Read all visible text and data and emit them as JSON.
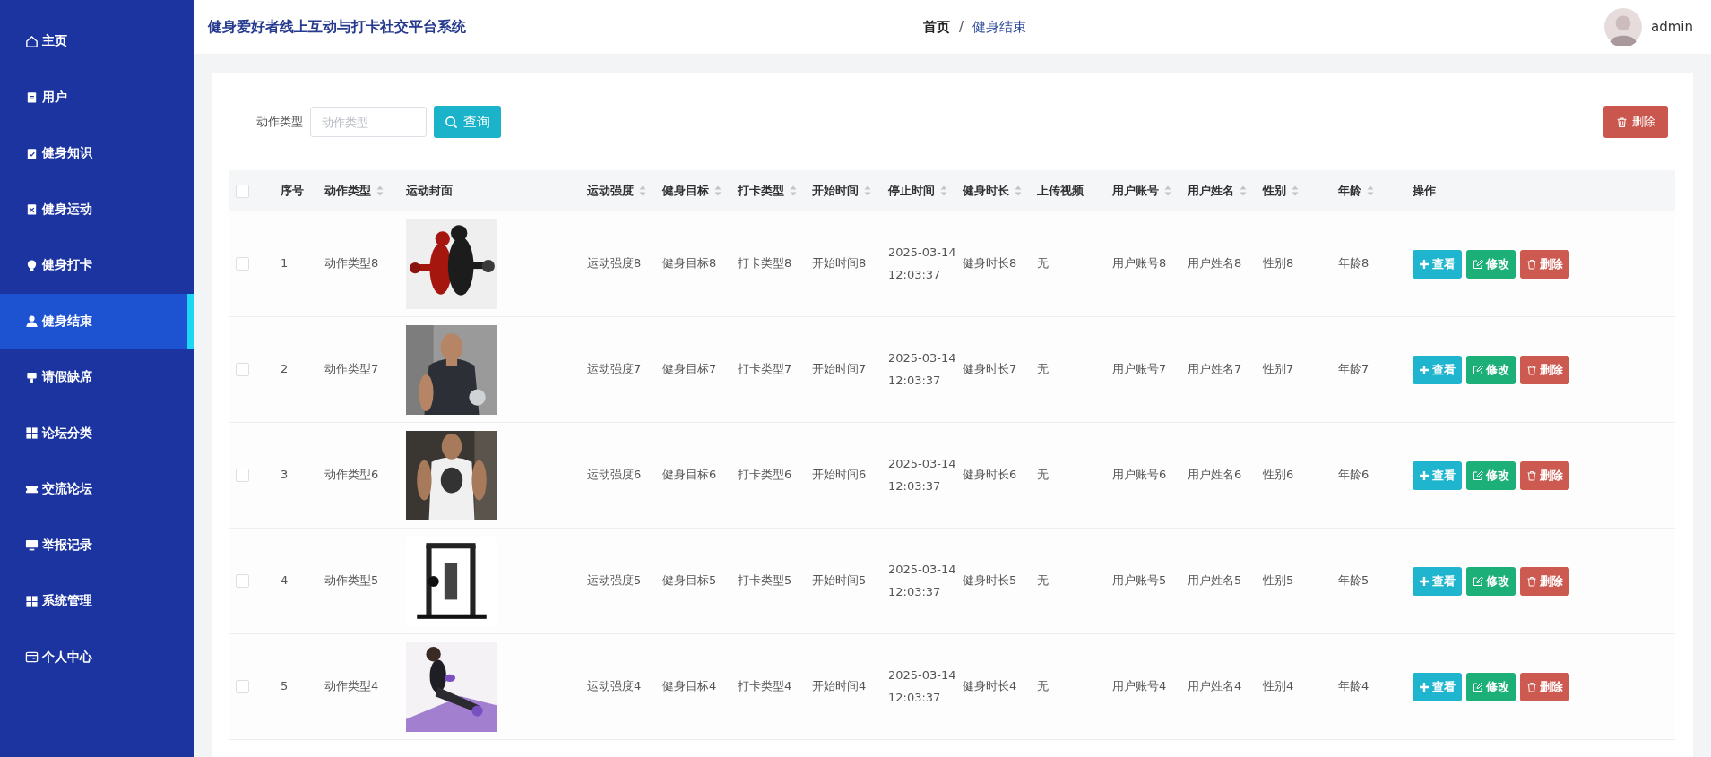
{
  "sidebar": {
    "items": [
      {
        "label": "主页",
        "selected": false
      },
      {
        "label": "用户",
        "selected": false
      },
      {
        "label": "健身知识",
        "selected": false
      },
      {
        "label": "健身运动",
        "selected": false
      },
      {
        "label": "健身打卡",
        "selected": false
      },
      {
        "label": "健身结束",
        "selected": true
      },
      {
        "label": "请假缺席",
        "selected": false
      },
      {
        "label": "论坛分类",
        "selected": false
      },
      {
        "label": "交流论坛",
        "selected": false
      },
      {
        "label": "举报记录",
        "selected": false
      },
      {
        "label": "系统管理",
        "selected": false
      },
      {
        "label": "个人中心",
        "selected": false
      }
    ]
  },
  "header": {
    "title": "健身爱好者线上互动与打卡社交平台系统",
    "breadcrumb": [
      "首页",
      "/",
      "健身结束"
    ],
    "user": "admin"
  },
  "search": {
    "label": "动作类型",
    "placeholder": "动作类型",
    "button": "查询"
  },
  "delete_button": "删除",
  "table": {
    "select_all": {
      "checked": false
    },
    "columns": [
      {
        "label": "序号",
        "sortable": false
      },
      {
        "label": "动作类型",
        "sortable": true
      },
      {
        "label": "运动封面",
        "sortable": false
      },
      {
        "label": "运动强度",
        "sortable": true
      },
      {
        "label": "健身目标",
        "sortable": true
      },
      {
        "label": "打卡类型",
        "sortable": true
      },
      {
        "label": "开始时间",
        "sortable": true
      },
      {
        "label": "停止时间",
        "sortable": true
      },
      {
        "label": "健身时长",
        "sortable": true
      },
      {
        "label": "上传视频",
        "sortable": false
      },
      {
        "label": "用户账号",
        "sortable": true
      },
      {
        "label": "用户姓名",
        "sortable": true
      },
      {
        "label": "性别",
        "sortable": true
      },
      {
        "label": "年龄",
        "sortable": true
      },
      {
        "label": "操作",
        "sortable": false
      }
    ],
    "rows": [
      {
        "selected": false,
        "actions": [
          {
            "label": "查看",
            "kind": "view"
          },
          {
            "label": "修改",
            "kind": "edit"
          },
          {
            "label": "删除",
            "kind": "delete"
          }
        ],
        "cells": [
          "1",
          "动作类型8",
          null,
          "运动强度8",
          "健身目标8",
          "打卡类型8",
          "开始时间8",
          "2025-03-14 12:03:37",
          "健身时长8",
          "无",
          "用户账号8",
          "用户姓名8",
          "性别8",
          "年龄8"
        ]
      },
      {
        "selected": false,
        "actions": [
          {
            "label": "查看",
            "kind": "view"
          },
          {
            "label": "修改",
            "kind": "edit"
          },
          {
            "label": "删除",
            "kind": "delete"
          }
        ],
        "cells": [
          "2",
          "动作类型7",
          null,
          "运动强度7",
          "健身目标7",
          "打卡类型7",
          "开始时间7",
          "2025-03-14 12:03:37",
          "健身时长7",
          "无",
          "用户账号7",
          "用户姓名7",
          "性别7",
          "年龄7"
        ]
      },
      {
        "selected": false,
        "actions": [
          {
            "label": "查看",
            "kind": "view"
          },
          {
            "label": "修改",
            "kind": "edit"
          },
          {
            "label": "删除",
            "kind": "delete"
          }
        ],
        "cells": [
          "3",
          "动作类型6",
          null,
          "运动强度6",
          "健身目标6",
          "打卡类型6",
          "开始时间6",
          "2025-03-14 12:03:37",
          "健身时长6",
          "无",
          "用户账号6",
          "用户姓名6",
          "性别6",
          "年龄6"
        ]
      },
      {
        "selected": false,
        "actions": [
          {
            "label": "查看",
            "kind": "view"
          },
          {
            "label": "修改",
            "kind": "edit"
          },
          {
            "label": "删除",
            "kind": "delete"
          }
        ],
        "cells": [
          "4",
          "动作类型5",
          null,
          "运动强度5",
          "健身目标5",
          "打卡类型5",
          "开始时间5",
          "2025-03-14 12:03:37",
          "健身时长5",
          "无",
          "用户账号5",
          "用户姓名5",
          "性别5",
          "年龄5"
        ]
      },
      {
        "selected": false,
        "actions": [
          {
            "label": "查看",
            "kind": "view"
          },
          {
            "label": "修改",
            "kind": "edit"
          },
          {
            "label": "删除",
            "kind": "delete"
          }
        ],
        "cells": [
          "5",
          "动作类型4",
          null,
          "运动强度4",
          "健身目标4",
          "打卡类型4",
          "开始时间4",
          "2025-03-14 12:03:37",
          "健身时长4",
          "无",
          "用户账号4",
          "用户姓名4",
          "性别4",
          "年龄4"
        ]
      }
    ]
  }
}
